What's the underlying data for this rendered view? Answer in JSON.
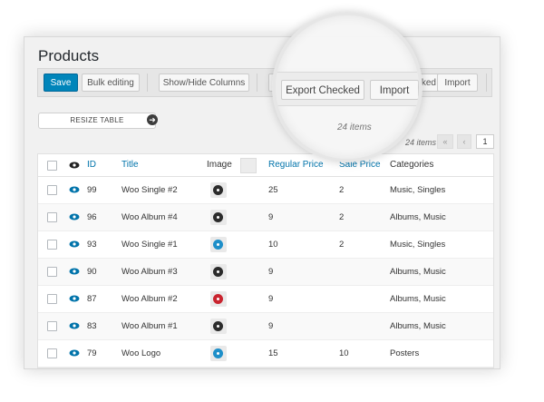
{
  "page": {
    "title": "Products"
  },
  "toolbar": {
    "save_label": "Save",
    "bulk_label": "Bulk editing",
    "showhide_label": "Show/Hide Columns",
    "checked_label": "ked",
    "import_label": "Import"
  },
  "magnifier": {
    "export_label": "Export Checked",
    "import_label": "Import",
    "count_text": "24 items"
  },
  "resize": {
    "label": "RESIZE TABLE"
  },
  "pagination": {
    "count_text": "24 items",
    "first": "«",
    "prev": "‹",
    "page": "1"
  },
  "table": {
    "headers": {
      "id": "ID",
      "title": "Title",
      "image": "Image",
      "regular_price": "Regular Price",
      "sale_price": "Sale Price",
      "categories": "Categories"
    },
    "rows": [
      {
        "id": "99",
        "title": "Woo Single #2",
        "regular": "25",
        "sale": "2",
        "categories": "Music, Singles",
        "thumb_color": "#2b2b2b"
      },
      {
        "id": "96",
        "title": "Woo Album #4",
        "regular": "9",
        "sale": "2",
        "categories": "Albums, Music",
        "thumb_color": "#2b2b2b"
      },
      {
        "id": "93",
        "title": "Woo Single #1",
        "regular": "10",
        "sale": "2",
        "categories": "Music, Singles",
        "thumb_color": "#1e8fc9"
      },
      {
        "id": "90",
        "title": "Woo Album #3",
        "regular": "9",
        "sale": "",
        "categories": "Albums, Music",
        "thumb_color": "#2b2b2b"
      },
      {
        "id": "87",
        "title": "Woo Album #2",
        "regular": "9",
        "sale": "",
        "categories": "Albums, Music",
        "thumb_color": "#c9242f"
      },
      {
        "id": "83",
        "title": "Woo Album #1",
        "regular": "9",
        "sale": "",
        "categories": "Albums, Music",
        "thumb_color": "#2b2b2b"
      },
      {
        "id": "79",
        "title": "Woo Logo",
        "regular": "15",
        "sale": "10",
        "categories": "Posters",
        "thumb_color": "#1e8fc9"
      }
    ]
  },
  "colors": {
    "primary": "#0085ba",
    "link": "#0073aa",
    "eye": "#0073aa"
  }
}
